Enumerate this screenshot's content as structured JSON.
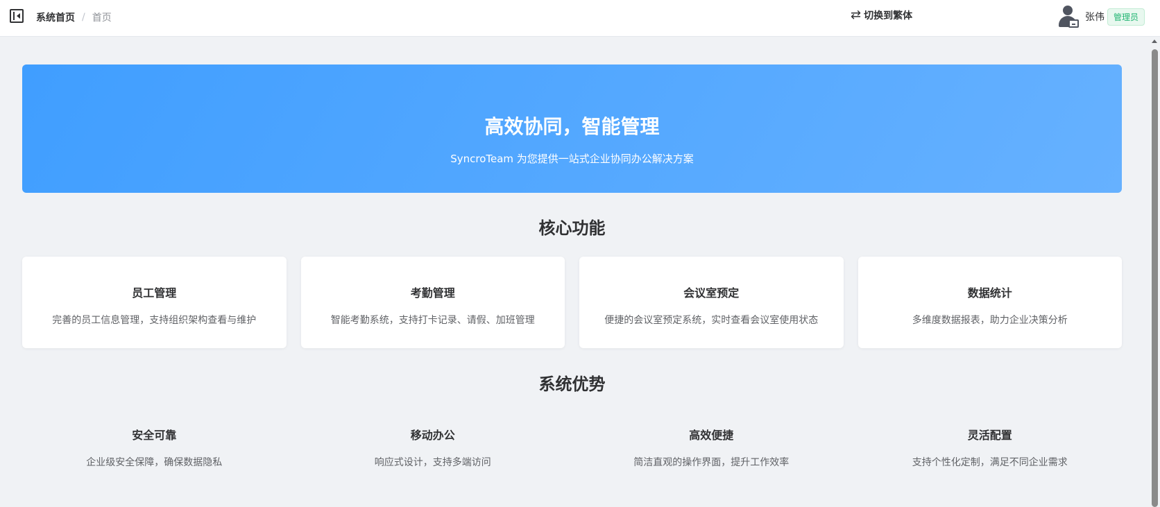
{
  "header": {
    "breadcrumb": {
      "root": "系统首页",
      "separator": "/",
      "current": "首页"
    },
    "lang_switch": "切换到繁体",
    "user": {
      "name": "张伟",
      "role": "管理员"
    }
  },
  "hero": {
    "title": "高效协同，智能管理",
    "subtitle": "SyncroTeam 为您提供一站式企业协同办公解决方案"
  },
  "features": {
    "title": "核心功能",
    "items": [
      {
        "title": "员工管理",
        "desc": "完善的员工信息管理，支持组织架构查看与维护"
      },
      {
        "title": "考勤管理",
        "desc": "智能考勤系统，支持打卡记录、请假、加班管理"
      },
      {
        "title": "会议室预定",
        "desc": "便捷的会议室预定系统，实时查看会议室使用状态"
      },
      {
        "title": "数据统计",
        "desc": "多维度数据报表，助力企业决策分析"
      }
    ]
  },
  "advantages": {
    "title": "系统优势",
    "items": [
      {
        "title": "安全可靠",
        "desc": "企业级安全保障，确保数据隐私"
      },
      {
        "title": "移动办公",
        "desc": "响应式设计，支持多端访问"
      },
      {
        "title": "高效便捷",
        "desc": "简洁直观的操作界面，提升工作效率"
      },
      {
        "title": "灵活配置",
        "desc": "支持个性化定制，满足不同企业需求"
      }
    ]
  },
  "colors": {
    "primary": "#409eff",
    "primary_light": "#66b1ff",
    "success": "#22b573",
    "background": "#f0f2f5"
  }
}
